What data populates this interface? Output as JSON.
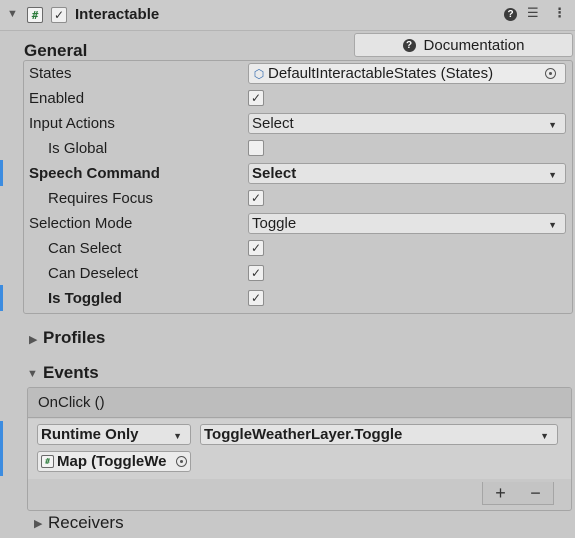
{
  "component": {
    "title": "Interactable",
    "enabled": true
  },
  "documentation_label": "Documentation",
  "general": {
    "title": "General",
    "states_label": "States",
    "states_value": "DefaultInteractableStates (States)",
    "enabled_label": "Enabled",
    "enabled": true,
    "input_actions_label": "Input Actions",
    "input_actions_value": "Select",
    "is_global_label": "Is Global",
    "is_global": false,
    "speech_command_label": "Speech Command",
    "speech_command_value": "Select",
    "requires_focus_label": "Requires Focus",
    "requires_focus": true,
    "selection_mode_label": "Selection Mode",
    "selection_mode_value": "Toggle",
    "can_select_label": "Can Select",
    "can_select": true,
    "can_deselect_label": "Can Deselect",
    "can_deselect": true,
    "is_toggled_label": "Is Toggled",
    "is_toggled": true
  },
  "profiles": {
    "title": "Profiles"
  },
  "events": {
    "title": "Events",
    "onclick_label": "OnClick ()",
    "runtime_value": "Runtime Only",
    "function_value": "ToggleWeatherLayer.Toggle",
    "object_value": "Map (ToggleWe",
    "add_symbol": "+",
    "remove_symbol": "−"
  },
  "receivers": {
    "title": "Receivers"
  },
  "colors": {
    "background": "#c8c8c8",
    "field": "#e4e4e4",
    "accent_bar": "#3c8ce0"
  }
}
